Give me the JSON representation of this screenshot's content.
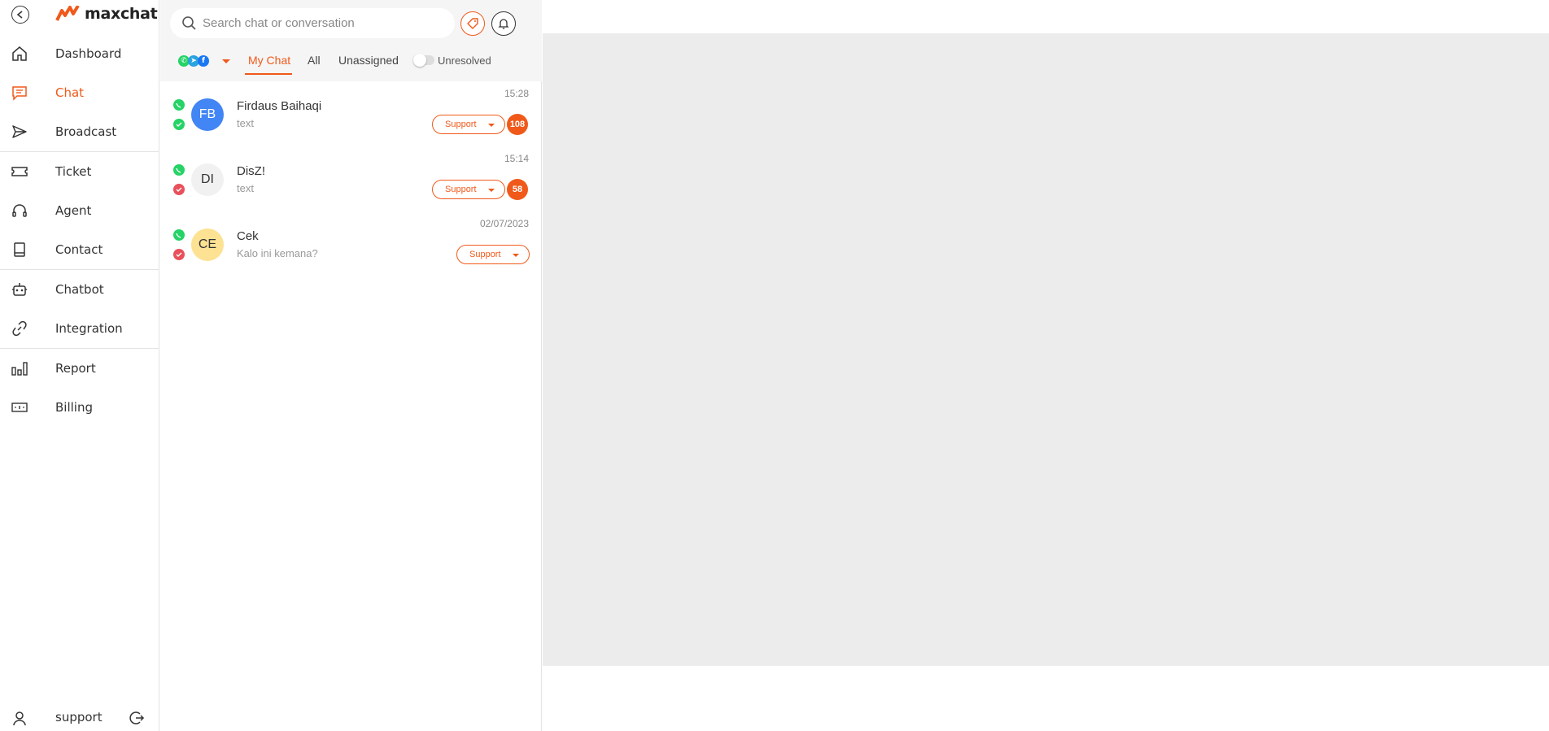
{
  "app": {
    "brand": "maxchat",
    "accent_color": "#f0591a"
  },
  "sidebar": {
    "items": [
      {
        "label": "Dashboard",
        "icon": "home-icon"
      },
      {
        "label": "Chat",
        "icon": "chat-icon",
        "active": true
      },
      {
        "label": "Broadcast",
        "icon": "send-icon"
      },
      {
        "label": "Ticket",
        "icon": "ticket-icon"
      },
      {
        "label": "Agent",
        "icon": "headset-icon"
      },
      {
        "label": "Contact",
        "icon": "contact-book-icon"
      },
      {
        "label": "Chatbot",
        "icon": "robot-icon"
      },
      {
        "label": "Integration",
        "icon": "link-icon"
      },
      {
        "label": "Report",
        "icon": "bar-chart-icon"
      },
      {
        "label": "Billing",
        "icon": "money-icon"
      }
    ],
    "user": {
      "name": "support"
    }
  },
  "chat_panel": {
    "search": {
      "placeholder": "Search chat or conversation"
    },
    "tabs": [
      "My Chat",
      "All",
      "Unassigned"
    ],
    "active_tab": "My Chat",
    "unresolved_label": "Unresolved",
    "chats": [
      {
        "initials": "FB",
        "name": "Firdaus Baihaqi",
        "preview": "text",
        "time": "15:28",
        "team": "Support",
        "unread": "108",
        "avatar_bg": "#4285f4",
        "avatar_fg": "#ffffff",
        "status_color": "#25d366"
      },
      {
        "initials": "DI",
        "name": "DisZ!",
        "preview": "text",
        "time": "15:14",
        "team": "Support",
        "unread": "58",
        "avatar_bg": "#f1f1f1",
        "avatar_fg": "#333333",
        "status_color": "#e8505b"
      },
      {
        "initials": "CE",
        "name": "Cek",
        "preview": "Kalo ini kemana?",
        "time": "02/07/2023",
        "team": "Support",
        "unread": "",
        "avatar_bg": "#fde293",
        "avatar_fg": "#333333",
        "status_color": "#e8505b"
      }
    ]
  }
}
